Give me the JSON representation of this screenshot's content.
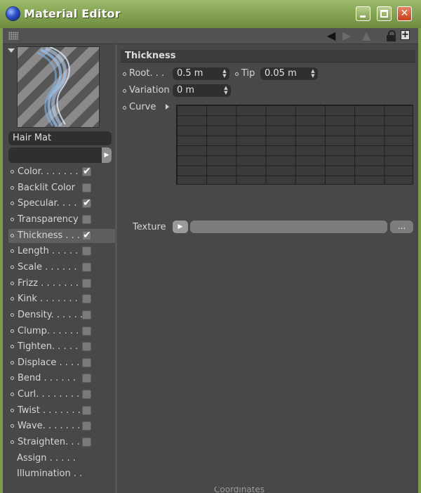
{
  "window": {
    "title": "Material Editor"
  },
  "titlebar": {
    "minimize": "minimize",
    "maximize": "maximize",
    "close": "✕"
  },
  "toolbar": {
    "icons": [
      "grip-icon",
      "back-arrow-icon",
      "forward-arrow-icon",
      "up-arrow-icon",
      "lock-icon",
      "new-window-icon"
    ],
    "new_window": "+"
  },
  "material": {
    "name": "Hair Mat",
    "field_button": "▶"
  },
  "channels": [
    {
      "label": "Color. . . . . . .",
      "checked": true
    },
    {
      "label": "Backlit Color",
      "checked": false
    },
    {
      "label": "Specular. . . .",
      "checked": true
    },
    {
      "label": "Transparency",
      "checked": false
    },
    {
      "label": "Thickness . . .",
      "checked": true,
      "selected": true
    },
    {
      "label": "Length . . . . .",
      "checked": false
    },
    {
      "label": "Scale . . . . . .",
      "checked": false
    },
    {
      "label": "Frizz . . . . . . .",
      "checked": false
    },
    {
      "label": "Kink . . . . . . .",
      "checked": false
    },
    {
      "label": "Density. . . . . .",
      "checked": false
    },
    {
      "label": "Clump. . . . . .",
      "checked": false
    },
    {
      "label": "Tighten. . . . .",
      "checked": false
    },
    {
      "label": "Displace . . . .",
      "checked": false
    },
    {
      "label": "Bend . . . . . .",
      "checked": false
    },
    {
      "label": "Curl. . . . . . . .",
      "checked": false
    },
    {
      "label": "Twist . . . . . . .",
      "checked": false
    },
    {
      "label": "Wave. . . . . . .",
      "checked": false
    },
    {
      "label": "Straighten. . .",
      "checked": false
    },
    {
      "label": "Assign . . . . ."
    },
    {
      "label": "Illumination . ."
    }
  ],
  "check_glyph": "✔",
  "thickness": {
    "title": "Thickness",
    "root_label": "Root. . .",
    "root_value": "0.5 m",
    "tip_label": "Tip",
    "tip_value": "0.05 m",
    "variation_label": "Variation",
    "variation_value": "0 m",
    "curve_label": "Curve",
    "texture_label": "Texture",
    "texture_play": "▶",
    "texture_more": "..."
  },
  "spinner_glyph": "▲\n▼",
  "background_window_text": "Coordinates"
}
